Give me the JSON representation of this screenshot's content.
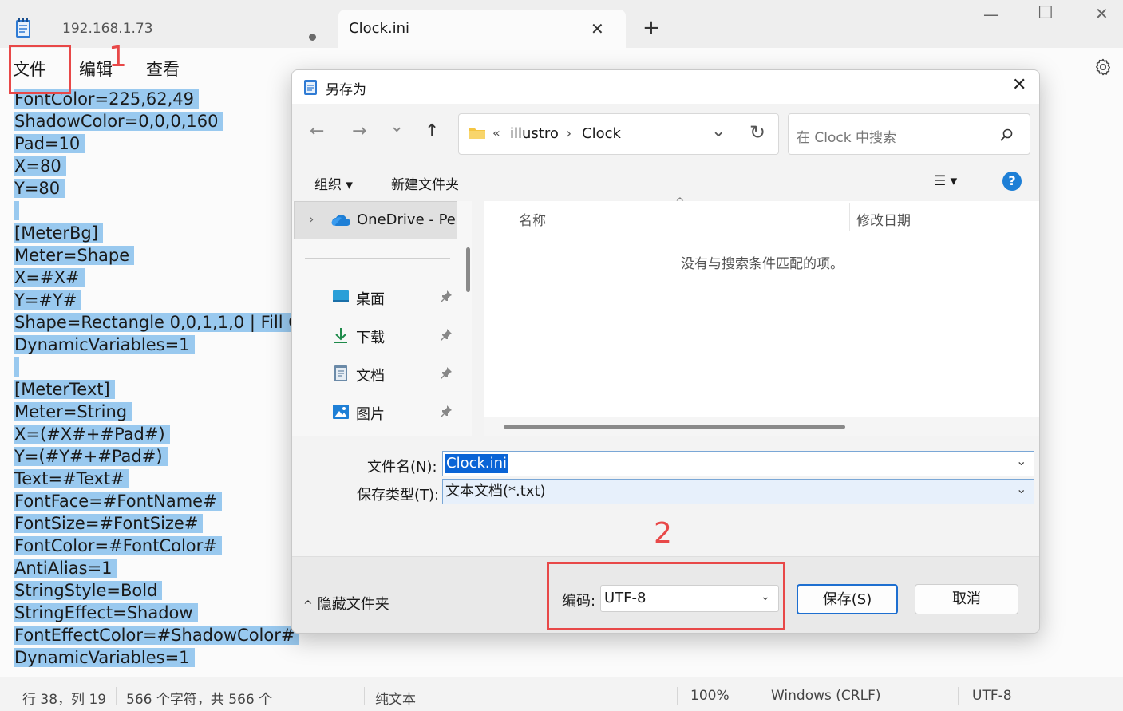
{
  "window": {
    "tabs": [
      {
        "title": "192.168.1.73",
        "unsaved": true
      },
      {
        "title": "Clock.ini",
        "close": "✕"
      }
    ],
    "new_tab": "+",
    "controls": {
      "minimize": "—",
      "maximize": "☐",
      "close": "✕"
    }
  },
  "menu": {
    "file": "文件",
    "edit": "编辑",
    "view": "查看"
  },
  "editor": {
    "lines": [
      {
        "text": "FontColor=225,62,49",
        "selected": true
      },
      {
        "text": "ShadowColor=0,0,0,160",
        "selected": true
      },
      {
        "text": "Pad=10",
        "selected": true
      },
      {
        "text": "X=80",
        "selected": true
      },
      {
        "text": "Y=80",
        "selected": true
      },
      {
        "text": "",
        "selected": true
      },
      {
        "text": "[MeterBg]",
        "selected": true
      },
      {
        "text": "Meter=Shape",
        "selected": true
      },
      {
        "text": "X=#X#",
        "selected": true
      },
      {
        "text": "Y=#Y#",
        "selected": true
      },
      {
        "text": "Shape=Rectangle 0,0,1,1,0 | Fill C",
        "selected": true
      },
      {
        "text": "DynamicVariables=1",
        "selected": true
      },
      {
        "text": "",
        "selected": true
      },
      {
        "text": "[MeterText]",
        "selected": true
      },
      {
        "text": "Meter=String",
        "selected": true
      },
      {
        "text": "X=(#X#+#Pad#)",
        "selected": true
      },
      {
        "text": "Y=(#Y#+#Pad#)",
        "selected": true
      },
      {
        "text": "Text=#Text#",
        "selected": true
      },
      {
        "text": "FontFace=#FontName#",
        "selected": true
      },
      {
        "text": "FontSize=#FontSize#",
        "selected": true
      },
      {
        "text": "FontColor=#FontColor#",
        "selected": true
      },
      {
        "text": "AntiAlias=1",
        "selected": true
      },
      {
        "text": "StringStyle=Bold",
        "selected": true
      },
      {
        "text": "StringEffect=Shadow",
        "selected": true
      },
      {
        "text": "FontEffectColor=#ShadowColor#",
        "selected": true
      },
      {
        "text": "DynamicVariables=1",
        "selected": true
      }
    ]
  },
  "status": {
    "position": "行 38，列 19",
    "chars": "566 个字符，共 566 个",
    "format": "纯文本",
    "zoom": "100%",
    "line_ending": "Windows (CRLF)",
    "encoding": "UTF-8"
  },
  "annotations": {
    "one": "1",
    "two": "2"
  },
  "dialog": {
    "title": "另存为",
    "close": "✕",
    "nav": {
      "back": "←",
      "forward": "→",
      "recent": "⌄",
      "up": "↑"
    },
    "address": {
      "overflow": "«",
      "crumbs": [
        "illustro",
        "Clock"
      ],
      "sep": "›",
      "dropdown": "⌄",
      "refresh": "↻"
    },
    "search_placeholder": "在 Clock 中搜索",
    "toolbar": {
      "organize": "组织 ▾",
      "new_folder": "新建文件夹",
      "view": "☰ ▾",
      "help": "?"
    },
    "nav_pane": {
      "onedrive": "OneDrive - Per",
      "expand": "›",
      "items": [
        {
          "label": "桌面",
          "icon": "desktop-icon"
        },
        {
          "label": "下载",
          "icon": "download-icon"
        },
        {
          "label": "文档",
          "icon": "document-icon"
        },
        {
          "label": "图片",
          "icon": "pictures-icon"
        }
      ]
    },
    "columns": {
      "name": "名称",
      "date": "修改日期",
      "sort": "^"
    },
    "empty_message": "没有与搜索条件匹配的项。",
    "filename_label": "文件名(N):",
    "filename_value": "Clock.ini",
    "filetype_label": "保存类型(T):",
    "filetype_value": "文本文档(*.txt)",
    "field_dropdown": "⌄",
    "hide_folders": "隐藏文件夹",
    "hide_chevron": "^",
    "encoding_label": "编码:",
    "encoding_value": "UTF-8",
    "encoding_dropdown": "⌄",
    "save_button": "保存(S)",
    "cancel_button": "取消"
  },
  "colors": {
    "selection": "#99c9ef",
    "annotation": "#e84848",
    "accent": "#1e6fd0"
  }
}
